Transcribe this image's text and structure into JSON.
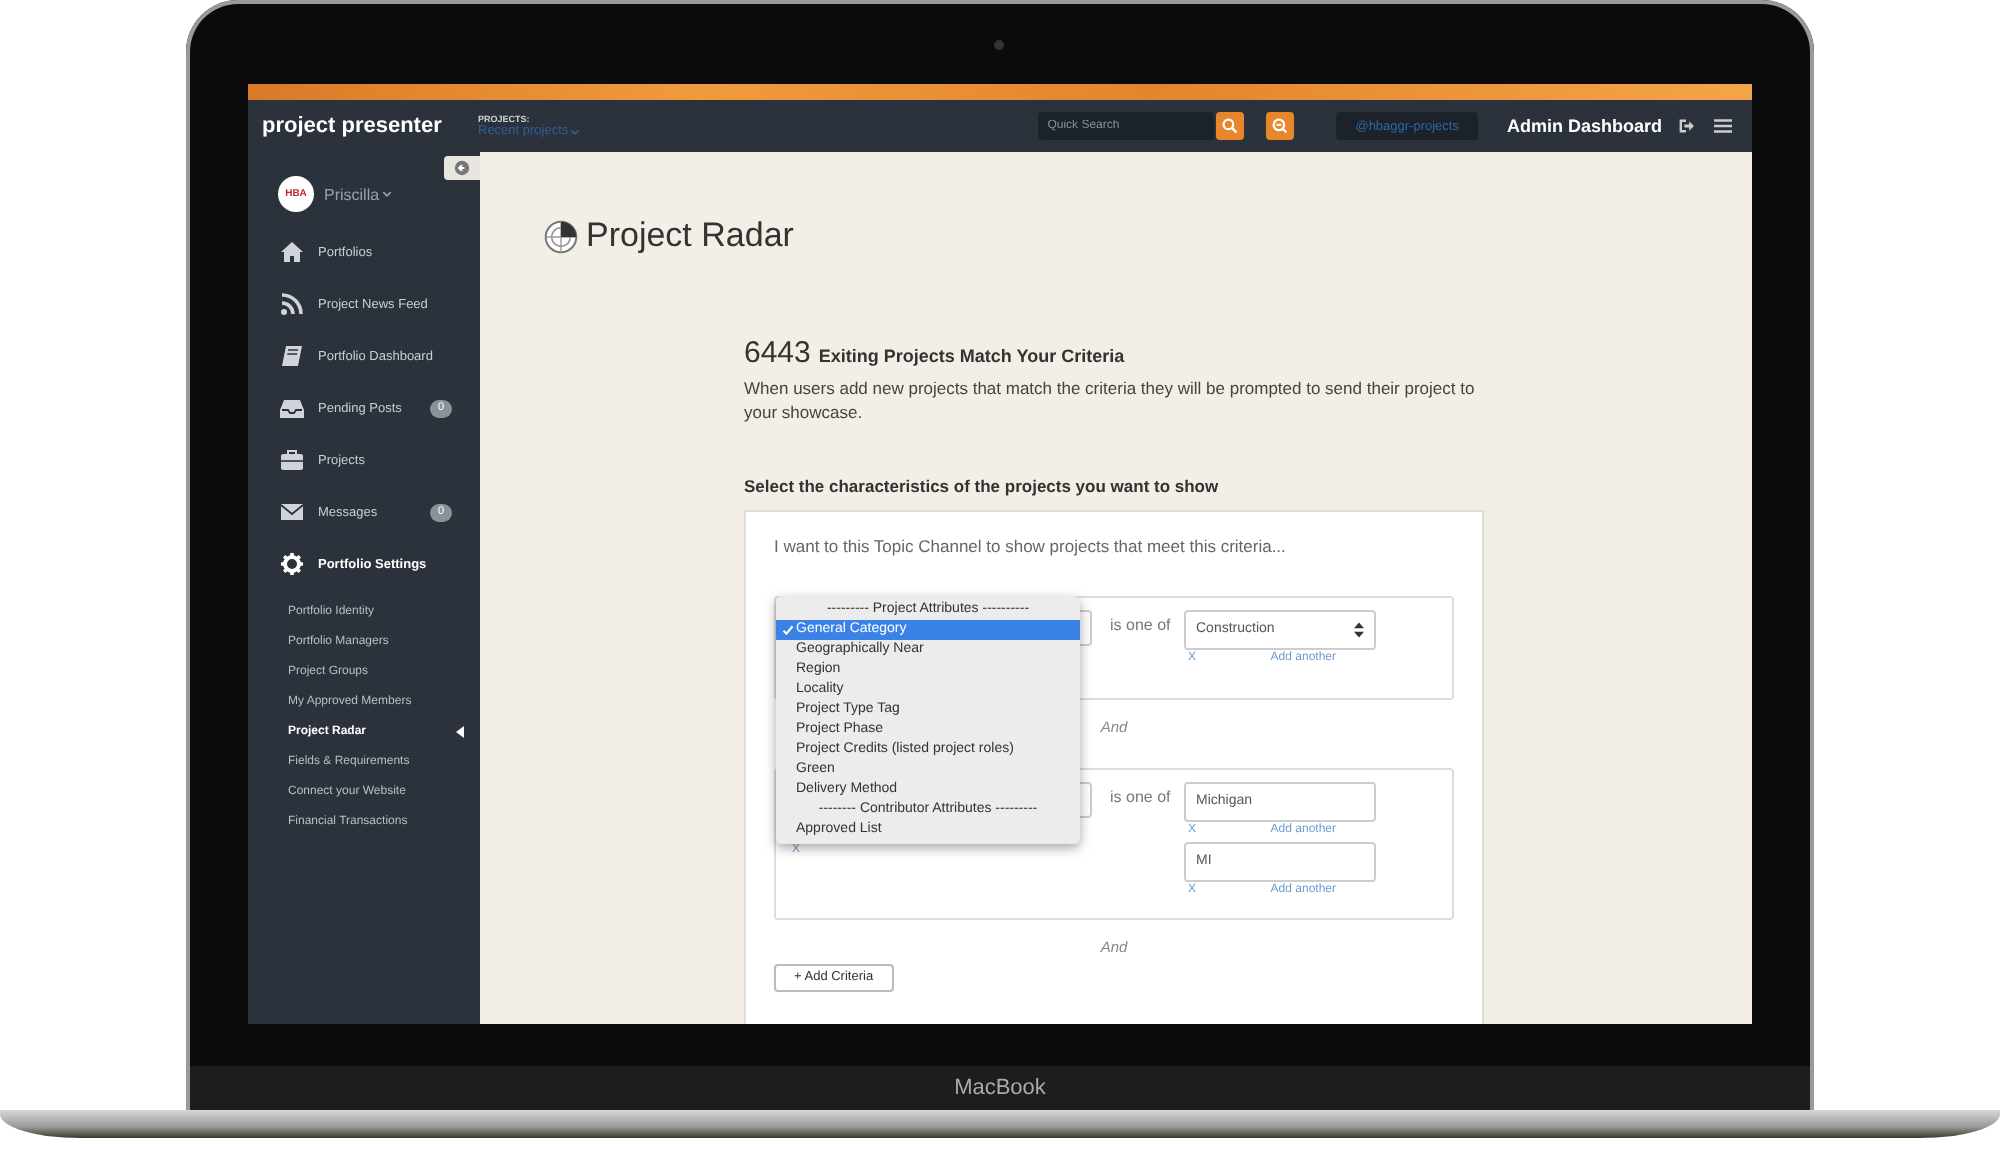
{
  "app": {
    "logo": "project presenter",
    "projects_label": "PROJECTS:",
    "projects_menu": "Recent projects",
    "search": {
      "placeholder": "Quick Search"
    },
    "account": "@hbaggr-projects",
    "admin": "Admin Dashboard"
  },
  "sidebar": {
    "avatar_label": "HBA",
    "user": "Priscilla",
    "items": [
      {
        "label": "Portfolios",
        "selected": false
      },
      {
        "label": "Project News Feed",
        "selected": false
      },
      {
        "label": "Portfolio Dashboard",
        "selected": false
      },
      {
        "label": "Pending Posts",
        "badge": "0",
        "selected": false
      },
      {
        "label": "Projects",
        "selected": false
      },
      {
        "label": "Messages",
        "badge": "0",
        "selected": false
      },
      {
        "label": "Portfolio Settings",
        "selected": true
      }
    ],
    "subitems": [
      {
        "label": "Portfolio Identity",
        "selected": false
      },
      {
        "label": "Portfolio Managers",
        "selected": false
      },
      {
        "label": "Project Groups",
        "selected": false
      },
      {
        "label": "My Approved Members",
        "selected": false
      },
      {
        "label": "Project Radar",
        "selected": true
      },
      {
        "label": "Fields & Requirements",
        "selected": false
      },
      {
        "label": "Connect your Website",
        "selected": false
      },
      {
        "label": "Financial Transactions",
        "selected": false
      }
    ]
  },
  "page": {
    "title": "Project Radar",
    "count": "6443",
    "count_label": "Exiting Projects Match Your Criteria",
    "description": "When users add new projects that match the criteria they will be prompted to send their project to your showcase.",
    "section_title": "Select the characteristics of the projects you want to show",
    "intro": "I want to this Topic Channel to show projects that meet this criteria...",
    "criteria": [
      {
        "operator": "is one of",
        "values": [
          {
            "kind": "select",
            "value": "Construction",
            "remove": "X",
            "add": "Add another"
          }
        ],
        "joiner": "And"
      },
      {
        "operator": "is one of",
        "field_remove": "X",
        "values": [
          {
            "kind": "text",
            "value": "Michigan",
            "remove": "X",
            "add": "Add another"
          },
          {
            "kind": "text",
            "value": "MI",
            "remove": "X",
            "add": "Add another"
          }
        ],
        "joiner": "And"
      }
    ],
    "add_button": "+ Add Criteria",
    "dropdown": {
      "options": [
        {
          "kind": "header",
          "label": "--------- Project Attributes ----------"
        },
        {
          "kind": "option",
          "label": "General Category",
          "selected": true
        },
        {
          "kind": "option",
          "label": "Geographically Near",
          "selected": false
        },
        {
          "kind": "option",
          "label": "Region",
          "selected": false
        },
        {
          "kind": "option",
          "label": "Locality",
          "selected": false
        },
        {
          "kind": "option",
          "label": "Project Type Tag",
          "selected": false
        },
        {
          "kind": "option",
          "label": "Project Phase",
          "selected": false
        },
        {
          "kind": "option",
          "label": "Project Credits (listed project roles)",
          "selected": false
        },
        {
          "kind": "option",
          "label": "Green",
          "selected": false
        },
        {
          "kind": "option",
          "label": "Delivery Method",
          "selected": false
        },
        {
          "kind": "header",
          "label": "-------- Contributor Attributes ---------"
        },
        {
          "kind": "option",
          "label": "Approved List",
          "selected": false
        }
      ]
    }
  },
  "device": {
    "label": "MacBook"
  }
}
